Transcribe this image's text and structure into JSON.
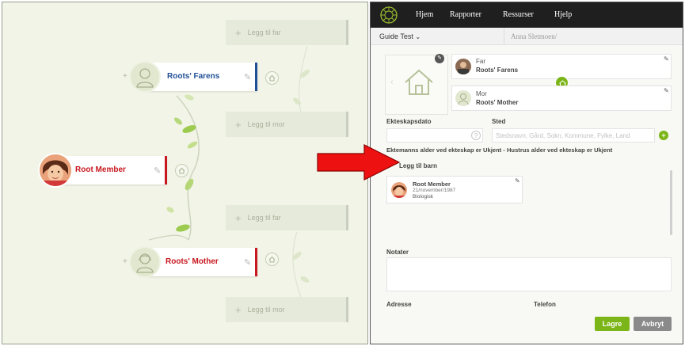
{
  "tree": {
    "add_father_label": "Legg til far",
    "add_mother_label": "Legg til mor",
    "father_name": "Roots' Farens",
    "mother_name": "Roots' Mother",
    "root_name": "Root Member",
    "icons": {
      "add": "plus-icon",
      "edit": "edit-icon",
      "family": "home-icon",
      "male": "male-silhouette-icon",
      "female": "female-silhouette-icon"
    }
  },
  "nav": {
    "items": [
      "Hjem",
      "Rapporter",
      "Ressurser",
      "Hjelp"
    ]
  },
  "subbar": {
    "guide_label": "Guide Test",
    "user_name": "Anna Sletmoen/"
  },
  "family": {
    "father_role": "Far",
    "father_name": "Roots' Farens",
    "mother_role": "Mor",
    "mother_name": "Roots' Mother"
  },
  "form": {
    "marriage_date_label": "Ekteskapsdato",
    "place_label": "Sted",
    "place_placeholder": "Stedsnavn, Gård, Sokn, Kommune, Fylke, Land",
    "age_text": "Ektemanns alder ved ekteskap er Ukjent - Hustrus alder ved ekteskap er Ukjent",
    "add_child_label": "Legg til barn",
    "child_name": "Root Member",
    "child_date": "21/november/1987",
    "child_relation": "Biologisk",
    "notes_label": "Notater",
    "address_label": "Adresse",
    "phone_label": "Telefon",
    "date_help": "?",
    "place_add": "+"
  },
  "buttons": {
    "save": "Lagre",
    "cancel": "Avbryt"
  },
  "colors": {
    "accent_green": "#7cb518",
    "father_blue": "#1f4f96",
    "mother_red": "#c8171e",
    "arrow_red": "#ee1111"
  }
}
